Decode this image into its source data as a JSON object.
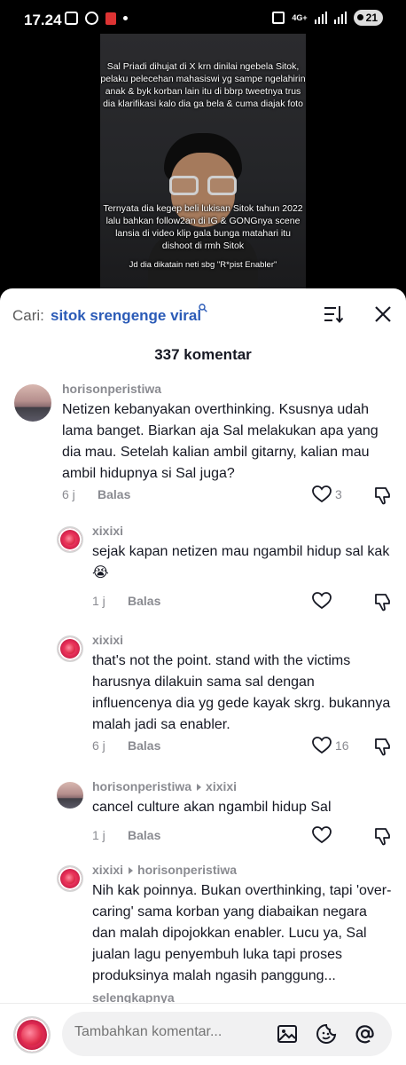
{
  "status_bar": {
    "time": "17.24",
    "network": "4G+",
    "battery": "21"
  },
  "video": {
    "caption_top": "Sal Priadi dihujat di X krn dinilai ngebela Sitok, pelaku pelecehan mahasiswi yg sampe ngelahirin anak & byk korban lain itu di bbrp tweetnya trus dia klarifikasi kalo dia ga bela & cuma diajak foto",
    "caption_middle": "Ternyata dia kegep beli lukisan Sitok tahun 2022 lalu bahkan follow2an di IG & GONGnya scene lansia di video klip gala bunga matahari itu dishoot di rmh Sitok",
    "caption_bottom": "Jd dia dikatain neti sbg \"R*pist Enabler\""
  },
  "search": {
    "label": "Cari:",
    "query": "sitok srengenge viral"
  },
  "comment_count": "337 komentar",
  "comments": [
    {
      "username": "horisonperistiwa",
      "text": "Netizen kebanyakan overthinking. Ksusnya udah lama banget. Biarkan aja Sal melakukan apa yang dia mau. Setelah kalian ambil gitarny, kalian mau ambil hidupnya si Sal juga?",
      "time": "6 j",
      "reply_label": "Balas",
      "likes": "3"
    },
    {
      "username": "xixixi",
      "text": "sejak kapan netizen mau ngambil hidup sal kak 😭",
      "time": "1 j",
      "reply_label": "Balas",
      "likes": ""
    },
    {
      "username": "xixixi",
      "text": "that's not the point. stand with the victims harusnya dilakuin sama sal dengan influencenya dia yg gede kayak skrg. bukannya malah jadi sa enabler.",
      "time": "6 j",
      "reply_label": "Balas",
      "likes": "16"
    },
    {
      "username": "horisonperistiwa",
      "reply_to": "xixixi",
      "text": "cancel culture akan ngambil hidup Sal",
      "time": "1 j",
      "reply_label": "Balas",
      "likes": ""
    },
    {
      "username": "xixixi",
      "reply_to": "horisonperistiwa",
      "text": "Nih kak poinnya. Bukan overthinking, tapi 'over-caring' sama korban yang diabaikan negara dan malah dipojokkan enabler. Lucu ya, Sal jualan lagu penyembuh luka tapi proses produksinya malah ngasih panggung...",
      "more_label": "selengkapnya"
    }
  ],
  "input": {
    "placeholder": "Tambahkan komentar..."
  },
  "colors": {
    "accent_link": "#2b5bb7",
    "muted": "#8a8b91",
    "text": "#161823"
  }
}
